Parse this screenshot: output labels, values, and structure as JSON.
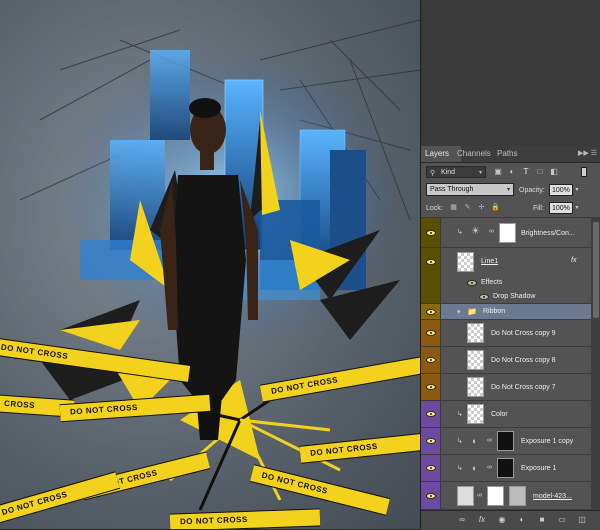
{
  "canvas": {
    "tapes": [
      {
        "text": "DO NOT CROSS"
      },
      {
        "text": "DO NOT CROSS"
      },
      {
        "text": "CROSS"
      },
      {
        "text": "DO NOT CROSS"
      },
      {
        "text": "DO NOT CROSS"
      },
      {
        "text": "DO NOT CROSS"
      },
      {
        "text": "DO NOT CROSS"
      },
      {
        "text": "DO NOT CROSS"
      },
      {
        "text": "DO NOT CROSS"
      }
    ],
    "colors": {
      "tape": "#f2d21c",
      "city": "#2f7fd0"
    }
  },
  "panel": {
    "tabs": [
      {
        "label": "Layers",
        "active": true
      },
      {
        "label": "Channels",
        "active": false
      },
      {
        "label": "Paths",
        "active": false
      }
    ],
    "tab_menu_icon": "panel-menu-icon",
    "filter": {
      "label": "Kind",
      "icon": "search-icon"
    },
    "filter_icons": [
      "pixel-filter-icon",
      "adjustment-filter-icon",
      "type-filter-icon",
      "shape-filter-icon",
      "smart-object-filter-icon"
    ],
    "blend_mode": "Pass Through",
    "opacity_label": "Opacity:",
    "opacity_value": "100%",
    "lock_label": "Lock:",
    "lock_icons": [
      "lock-transparent-icon",
      "lock-image-icon",
      "lock-position-icon",
      "lock-all-icon"
    ],
    "fill_label": "Fill:",
    "fill_value": "100%",
    "layers": [
      {
        "name": "Brightness/Con...",
        "type": "adjustment",
        "eye": "#5a4f00"
      },
      {
        "name": "Line1",
        "type": "pixel-fx",
        "eye": "#5a4f00",
        "fx": "fx"
      },
      {
        "name": "Effects",
        "type": "effects",
        "eye": "#5a4f00"
      },
      {
        "name": "Drop Shadow",
        "type": "effect",
        "eye": "#5a4f00"
      },
      {
        "name": "Ribbon",
        "type": "group",
        "eye": "#8a6a10"
      },
      {
        "name": "Do Not Cross copy 9",
        "type": "pixel",
        "eye": "#8a5a10"
      },
      {
        "name": "Do Not Cross copy 8",
        "type": "pixel",
        "eye": "#8a5a10"
      },
      {
        "name": "Do Not Cross copy 7",
        "type": "pixel",
        "eye": "#8a5a10"
      },
      {
        "name": "Color",
        "type": "adjustment",
        "eye": "#6b4aa0"
      },
      {
        "name": "Exposure 1 copy",
        "type": "adjustment",
        "eye": "#6b4aa0"
      },
      {
        "name": "Exposure 1",
        "type": "adjustment",
        "eye": "#6b4aa0"
      },
      {
        "name": "model-423...",
        "type": "smart",
        "eye": "#6b4aa0"
      }
    ],
    "bottom_icons": [
      "link-icon",
      "fx-icon",
      "mask-icon",
      "adjustment-icon",
      "folder-icon",
      "new-layer-icon",
      "trash-icon"
    ]
  }
}
